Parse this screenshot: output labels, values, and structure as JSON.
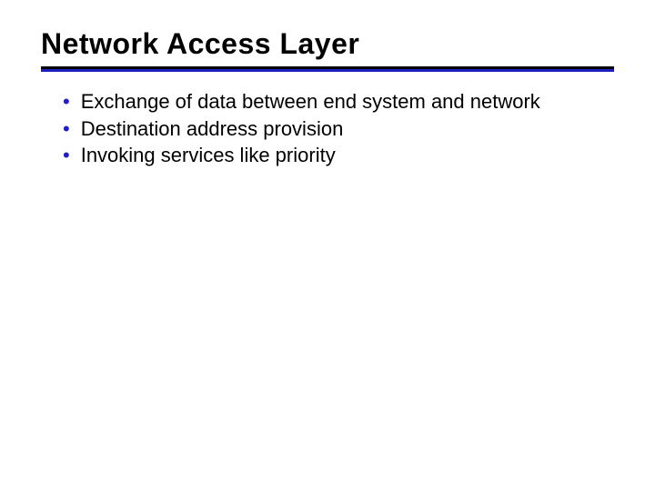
{
  "title": "Network Access Layer",
  "bullets": [
    "Exchange of data between end system and network",
    "Destination address provision",
    "Invoking services like priority"
  ],
  "colors": {
    "blue": "#2020c0",
    "black": "#000000"
  }
}
